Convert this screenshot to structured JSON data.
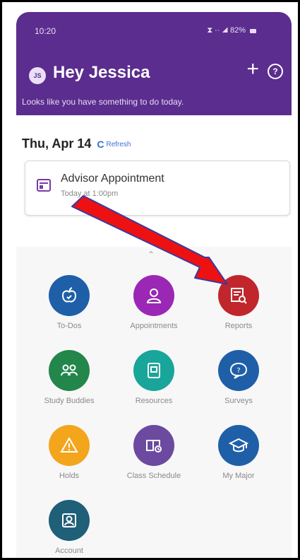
{
  "status_bar": {
    "time": "10:20",
    "indicators": "⧗ ·· ◢ 82%"
  },
  "header": {
    "avatar_initials": "JS",
    "greeting": "Hey Jessica",
    "add_label": "+",
    "help_label": "?",
    "subtitle": "Looks like you have something to do today."
  },
  "date": {
    "label": "Thu, Apr 14",
    "refresh_label": "Refresh",
    "refresh_icon": "C"
  },
  "appointment": {
    "title": "Advisor Appointment",
    "time": "Today at 1:00pm"
  },
  "tiles": [
    {
      "label": "To-Dos",
      "color": "#1f5fa8",
      "icon": "apple-icon"
    },
    {
      "label": "Appointments",
      "color": "#9b27b5",
      "icon": "person-icon"
    },
    {
      "label": "Reports",
      "color": "#c0262b",
      "icon": "report-search-icon"
    },
    {
      "label": "Study Buddies",
      "color": "#23864a",
      "icon": "people-icon"
    },
    {
      "label": "Resources",
      "color": "#19a59a",
      "icon": "book-icon"
    },
    {
      "label": "Surveys",
      "color": "#1f5fa8",
      "icon": "speech-question-icon"
    },
    {
      "label": "Holds",
      "color": "#f3a51c",
      "icon": "warning-icon"
    },
    {
      "label": "Class Schedule",
      "color": "#6b4aa0",
      "icon": "schedule-icon"
    },
    {
      "label": "My Major",
      "color": "#1f5fa8",
      "icon": "graduation-cap-icon"
    },
    {
      "label": "Account",
      "color": "#1f5f78",
      "icon": "account-icon"
    }
  ],
  "annotation": {
    "arrow_color": "#ee1111"
  }
}
